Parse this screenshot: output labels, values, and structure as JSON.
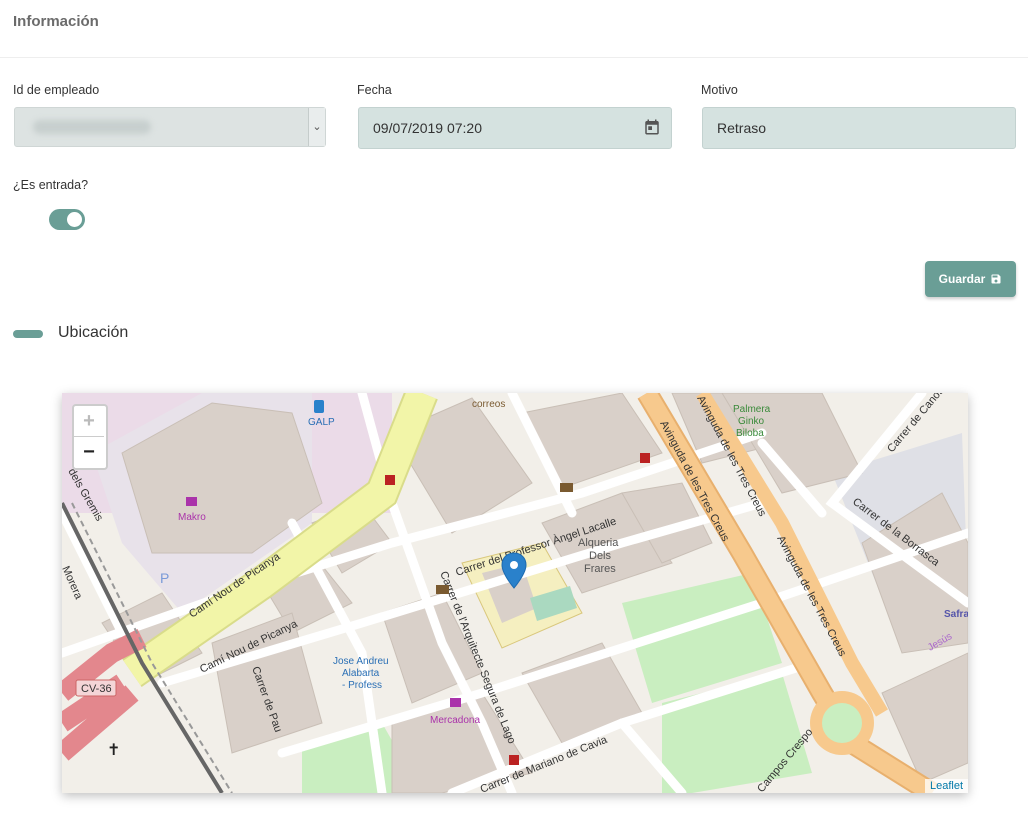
{
  "section": {
    "title": "Información"
  },
  "fields": {
    "employee": {
      "label": "Id de empleado",
      "value": ""
    },
    "date": {
      "label": "Fecha",
      "value": "09/07/2019 07:20"
    },
    "reason": {
      "label": "Motivo",
      "value": "Retraso"
    },
    "is_entry": {
      "label": "¿Es entrada?",
      "checked": true
    }
  },
  "actions": {
    "save_label": "Guardar"
  },
  "location": {
    "title": "Ubicación"
  },
  "map": {
    "zoom_in": "+",
    "zoom_out": "−",
    "attribution": "Leaflet",
    "streets": {
      "cami_nou": "Camí Nou de Picanya",
      "cami_nou_2": "Camí Nou de Picanya",
      "professor": "Carrer del Professor Àngel Lacalle",
      "arquitecte": "Carrer de l'Arquitecte Segura de Lago",
      "tres_creus_1": "Avinguda de les Tres Creus",
      "tres_creus_2": "Avinguda de les Tres Creus",
      "tres_creus_3": "Avinguda de les Tres Creus",
      "mariano": "Carrer de Mariano de Cavia",
      "pau": "Carrer de Pau",
      "borrasca": "Carrer de la Borrasca",
      "canos": "Carrer de Canos",
      "gremis": "dels Gremis",
      "morera": "Morera",
      "cv36": "CV-36",
      "campos": "Campos Crespo"
    },
    "pois": {
      "correos": "correos",
      "galp": "GALP",
      "makro": "Makro",
      "alqueria_1": "Alqueria",
      "alqueria_2": "Dels",
      "alqueria_3": "Frares",
      "jose_1": "Jose Andreu",
      "jose_2": "Alabarta",
      "jose_3": "- Profess",
      "mercadona": "Mercadona",
      "palmera_1": "Palmera",
      "palmera_2": "Ginko",
      "palmera_3": "Biloba",
      "safra": "Safra",
      "jesus": "Jesús"
    }
  },
  "colors": {
    "accent": "#6a9e96",
    "field_bg": "#d5e2e0",
    "select_bg": "#dde3e2",
    "highway": "#e3878d",
    "avenue": "#f7c98d",
    "trunk": "#f2f5a8",
    "park": "#c9eec0",
    "building": "#d9d0c9",
    "marker": "#2a81cb"
  },
  "icons": {
    "calendar": "calendar-icon",
    "save": "floppy-disk-icon",
    "marker": "map-marker-icon"
  }
}
